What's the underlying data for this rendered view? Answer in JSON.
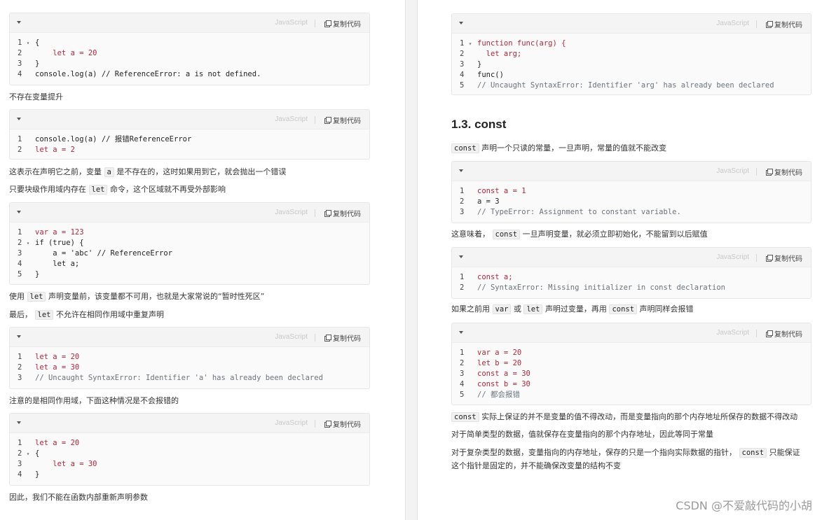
{
  "common": {
    "lang": "JavaScript",
    "copy": "复制代码"
  },
  "left": {
    "block1": [
      "{",
      "    let a = 20",
      "}",
      "console.log(a) // ReferenceError: a is not defined."
    ],
    "p1": "不存在变量提升",
    "block2": [
      "console.log(a) // 报错ReferenceError",
      "let a = 2"
    ],
    "p2_a": "这表示在声明它之前，变量",
    "p2_b": "a",
    "p2_c": "是不存在的，这时如果用到它，就会抛出一个错误",
    "p3_a": "只要块级作用域内存在",
    "p3_b": "let",
    "p3_c": "命令，这个区域就不再受外部影响",
    "block3": [
      "var a = 123",
      "if (true) {",
      "    a = 'abc' // ReferenceError",
      "    let a;",
      "}"
    ],
    "p4_a": "使用",
    "p4_b": "let",
    "p4_c": "声明变量前，该变量都不可用，也就是大家常说的“暂时性死区”",
    "p5_a": "最后，",
    "p5_b": "let",
    "p5_c": "不允许在相同作用域中重复声明",
    "block4": [
      "let a = 20",
      "let a = 30",
      "// Uncaught SyntaxError: Identifier 'a' has already been declared"
    ],
    "p6": "注意的是相同作用域，下面这种情况是不会报错的",
    "block5": [
      "let a = 20",
      "{",
      "    let a = 30",
      "}"
    ],
    "p7": "因此，我们不能在函数内部重新声明参数"
  },
  "right": {
    "block1": [
      "function func(arg) {",
      "  let arg;",
      "}",
      "func()",
      "// Uncaught SyntaxError: Identifier 'arg' has already been declared"
    ],
    "heading": "1.3. const",
    "p1_a": "const",
    "p1_b": "声明一个只读的常量，一旦声明，常量的值就不能改变",
    "block2": [
      "const a = 1",
      "a = 3",
      "// TypeError: Assignment to constant variable."
    ],
    "p2_a": "这意味着，",
    "p2_b": "const",
    "p2_c": "一旦声明变量，就必须立即初始化，不能留到以后赋值",
    "block3": [
      "const a;",
      "// SyntaxError: Missing initializer in const declaration"
    ],
    "p3_a": "如果之前用",
    "p3_b": "var",
    "p3_c": "或",
    "p3_d": "let",
    "p3_e": "声明过变量，再用",
    "p3_f": "const",
    "p3_g": "声明同样会报错",
    "block4": [
      "var a = 20",
      "let b = 20",
      "const a = 30",
      "const b = 30",
      "// 都会报错"
    ],
    "p4_a": "const",
    "p4_b": "实际上保证的并不是变量的值不得改动，而是变量指向的那个内存地址所保存的数据不得改动",
    "p5": "对于简单类型的数据，值就保存在变量指向的那个内存地址，因此等同于常量",
    "p6_a": "对于复杂类型的数据，变量指向的内存地址，保存的只是一个指向实际数据的指针，",
    "p6_b": "const",
    "p6_c": "只能保证",
    "p6_d": "这个指针是固定的，并不能确保改变量的结构不变"
  },
  "watermark": "CSDN @不爱敲代码的小胡"
}
